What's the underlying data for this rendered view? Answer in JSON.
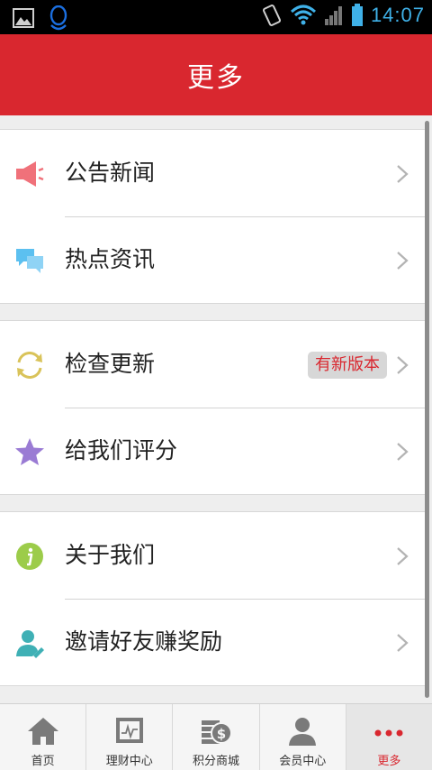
{
  "status_bar": {
    "time": "14:07"
  },
  "header": {
    "title": "更多"
  },
  "groups": [
    {
      "items": [
        {
          "label": "公告新闻",
          "icon": "megaphone-icon"
        },
        {
          "label": "热点资讯",
          "icon": "chat-bubbles-icon"
        }
      ]
    },
    {
      "items": [
        {
          "label": "检查更新",
          "icon": "refresh-icon",
          "badge": "有新版本"
        },
        {
          "label": "给我们评分",
          "icon": "star-icon"
        }
      ]
    },
    {
      "items": [
        {
          "label": "关于我们",
          "icon": "info-icon"
        },
        {
          "label": "邀请好友赚奖励",
          "icon": "invite-user-icon"
        }
      ]
    }
  ],
  "tabbar": {
    "tabs": [
      {
        "label": "首页",
        "icon": "home-icon"
      },
      {
        "label": "理财中心",
        "icon": "chart-board-icon"
      },
      {
        "label": "积分商城",
        "icon": "points-coin-icon"
      },
      {
        "label": "会员中心",
        "icon": "member-person-icon"
      },
      {
        "label": "更多",
        "icon": "more-dots-icon",
        "active": true
      }
    ]
  },
  "colors": {
    "brand_red": "#d9272f",
    "status_blue": "#3fb1e8"
  }
}
